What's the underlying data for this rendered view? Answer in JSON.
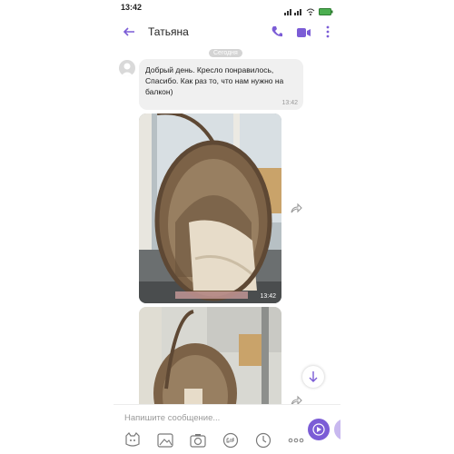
{
  "status": {
    "time": "13:42"
  },
  "header": {
    "contact_name": "Татьяна"
  },
  "chat": {
    "date_label": "Сегодня",
    "message": {
      "text": "Добрый день. Кресло понравилось, Спасибо. Как раз то, что нам нужно на балкон)",
      "time": "13:42"
    },
    "photo1_time": "13:42"
  },
  "input": {
    "placeholder": "Напишите сообщение..."
  },
  "colors": {
    "accent": "#7b5cd6",
    "bubble": "#f0f0f0"
  },
  "icons": [
    "back-arrow-icon",
    "phone-icon",
    "video-camera-icon",
    "more-vertical-icon",
    "share-icon",
    "scroll-down-icon",
    "sticker-icon",
    "gallery-icon",
    "camera-icon",
    "gif-icon",
    "clock-icon",
    "more-horizontal-icon",
    "send-icon"
  ]
}
